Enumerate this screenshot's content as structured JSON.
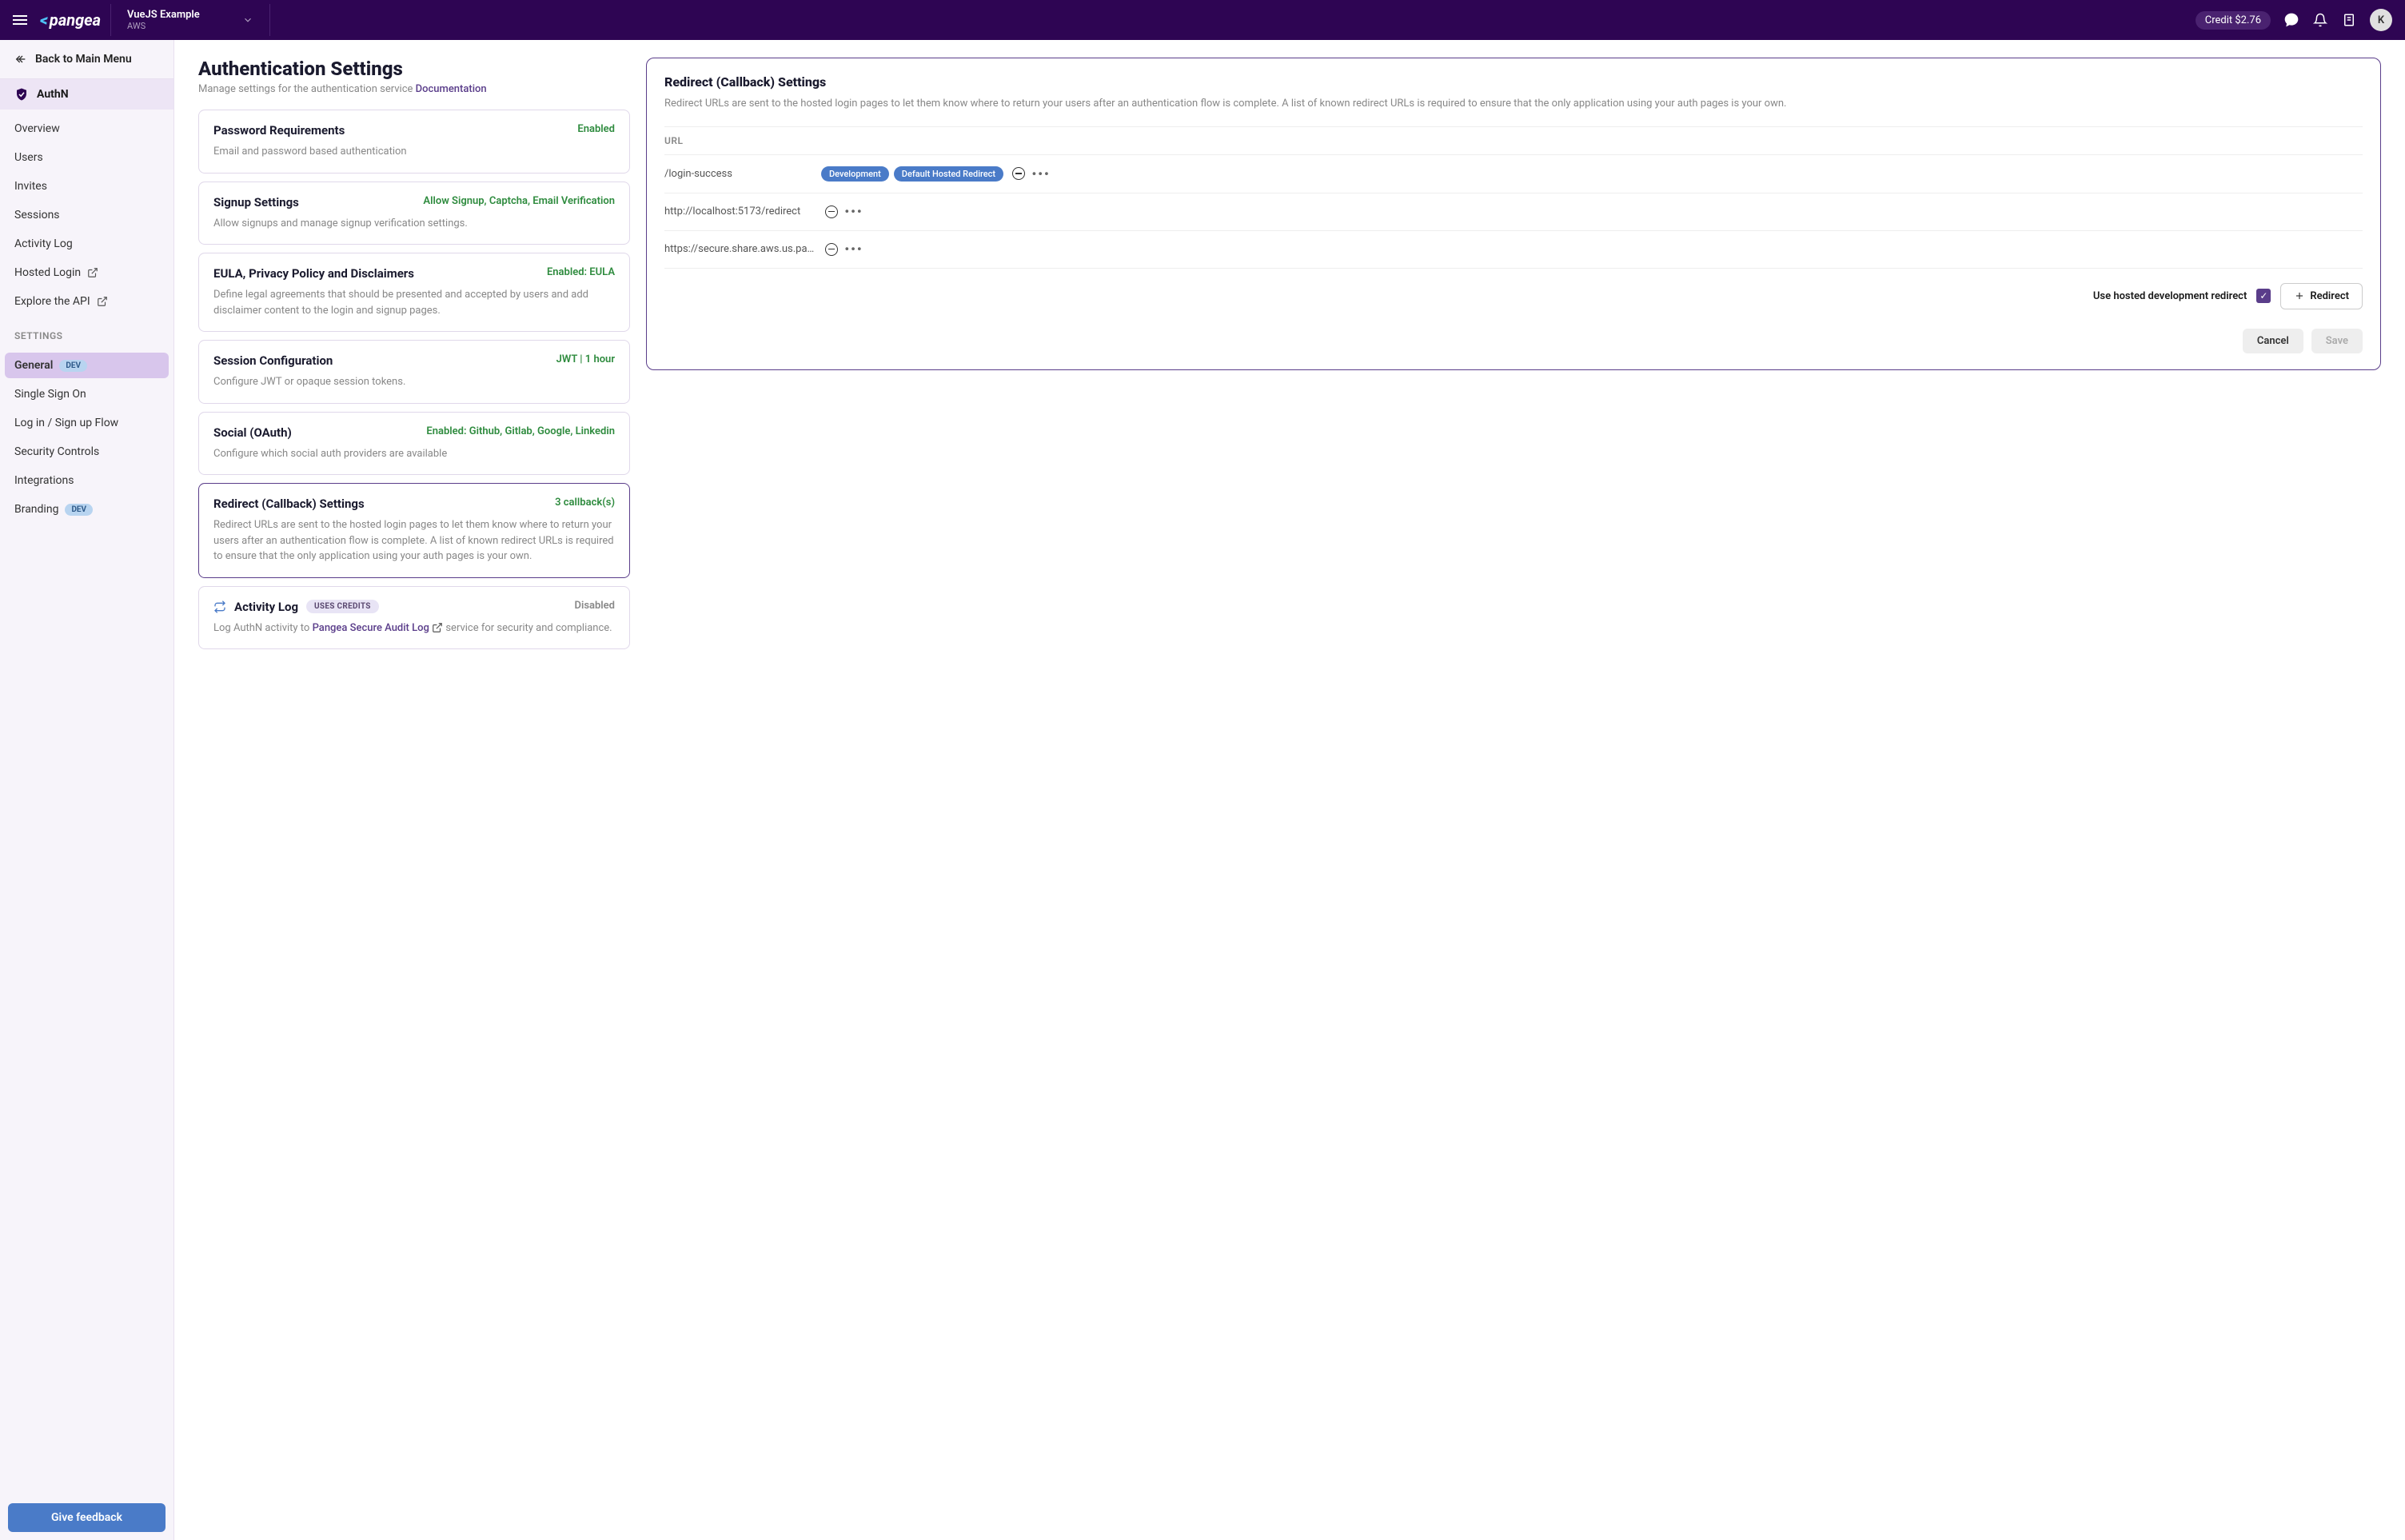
{
  "topbar": {
    "logo": "pangea",
    "project_name": "VueJS Example",
    "project_sub": "AWS",
    "credit": "Credit $2.76",
    "avatar": "K"
  },
  "sidebar": {
    "back": "Back to Main Menu",
    "service": "AuthN",
    "nav": [
      "Overview",
      "Users",
      "Invites",
      "Sessions",
      "Activity Log",
      "Hosted Login",
      "Explore the API"
    ],
    "settings_label": "SETTINGS",
    "settings": [
      {
        "label": "General",
        "dev": true,
        "active": true
      },
      {
        "label": "Single Sign On"
      },
      {
        "label": "Log in / Sign up Flow"
      },
      {
        "label": "Security Controls"
      },
      {
        "label": "Integrations"
      },
      {
        "label": "Branding",
        "dev": true
      }
    ],
    "dev_badge": "DEV",
    "feedback": "Give feedback"
  },
  "page": {
    "title": "Authentication Settings",
    "subtitle": "Manage settings for the authentication service ",
    "doc_link": "Documentation"
  },
  "cards": [
    {
      "title": "Password Requirements",
      "status": "Enabled",
      "desc": "Email and password based authentication"
    },
    {
      "title": "Signup Settings",
      "status": "Allow Signup, Captcha, Email Verification",
      "desc": "Allow signups and manage signup verification settings."
    },
    {
      "title": "EULA, Privacy Policy and Disclaimers",
      "status": "Enabled: EULA",
      "desc": "Define legal agreements that should be presented and accepted by users and add disclaimer content to the login and signup pages."
    },
    {
      "title": "Session Configuration",
      "status": "JWT | 1 hour",
      "desc": "Configure JWT or opaque session tokens."
    },
    {
      "title": "Social (OAuth)",
      "status": "Enabled: Github, Gitlab, Google, Linkedin",
      "desc": "Configure which social auth providers are available"
    },
    {
      "title": "Redirect (Callback) Settings",
      "status": "3 callback(s)",
      "desc": "Redirect URLs are sent to the hosted login pages to let them know where to return your users after an authentication flow is complete. A list of known redirect URLs is required to ensure that the only application using your auth pages is your own.",
      "selected": true
    },
    {
      "title": "Activity Log",
      "status": "Disabled",
      "disabled": true,
      "uses_credits": "USES CREDITS",
      "activity": true,
      "desc_pre": "Log AuthN activity to ",
      "desc_link": "Pangea Secure Audit Log",
      "desc_post": " service for security and compliance."
    }
  ],
  "detail": {
    "title": "Redirect (Callback) Settings",
    "desc": "Redirect URLs are sent to the hosted login pages to let them know where to return your users after an authentication flow is complete. A list of known redirect URLs is required to ensure that the only application using your auth pages is your own.",
    "url_header": "URL",
    "rows": [
      {
        "url": "/login-success",
        "pills": [
          "Development",
          "Default Hosted Redirect"
        ]
      },
      {
        "url": "http://localhost:5173/redirect",
        "pills": []
      },
      {
        "url": "https://secure.share.aws.us.pang",
        "pills": []
      }
    ],
    "hosted_label": "Use hosted development redirect",
    "redirect_btn": "Redirect",
    "cancel": "Cancel",
    "save": "Save"
  }
}
